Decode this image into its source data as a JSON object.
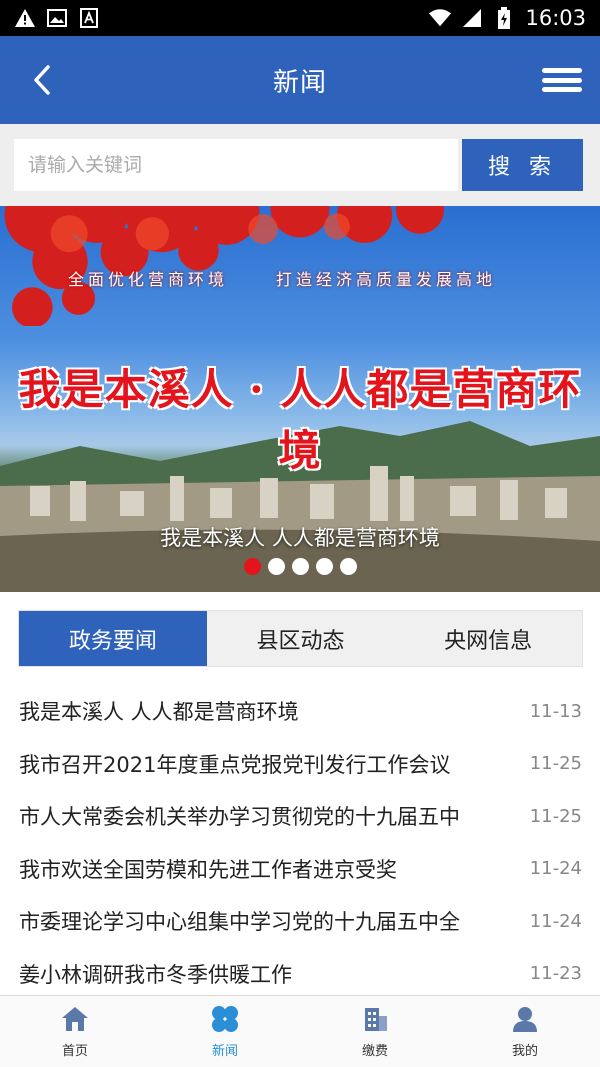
{
  "status_bar": {
    "time": "16:03",
    "icons_left": [
      "warning-icon",
      "image-icon",
      "font-icon"
    ],
    "icons_right": [
      "wifi-icon",
      "signal-icon",
      "battery-icon"
    ]
  },
  "header": {
    "title": "新闻",
    "back_icon": "chevron-left-icon",
    "menu_icon": "hamburger-icon"
  },
  "search": {
    "placeholder": "请输入关键词",
    "button_label": "搜 索"
  },
  "banner": {
    "slogan_left": "全面优化营商环境",
    "slogan_right": "打造经济高质量发展高地",
    "headline": "我是本溪人 · 人人都是营商环境",
    "caption": "我是本溪人 人人都是营商环境",
    "dots": 5,
    "active_dot": 0
  },
  "tabs": [
    {
      "label": "政务要闻",
      "active": true
    },
    {
      "label": "县区动态",
      "active": false
    },
    {
      "label": "央网信息",
      "active": false
    }
  ],
  "news": [
    {
      "title": "我是本溪人 人人都是营商环境",
      "date": "11-13"
    },
    {
      "title": "我市召开2021年度重点党报党刊发行工作会议",
      "date": "11-25"
    },
    {
      "title": "市人大常委会机关举办学习贯彻党的十九届五中",
      "date": "11-25"
    },
    {
      "title": "我市欢送全国劳模和先进工作者进京受奖",
      "date": "11-24"
    },
    {
      "title": "市委理论学习中心组集中学习党的十九届五中全",
      "date": "11-24"
    },
    {
      "title": "姜小林调研我市冬季供暖工作",
      "date": "11-23"
    }
  ],
  "bottom_nav": [
    {
      "label": "首页",
      "icon": "home-icon",
      "active": false
    },
    {
      "label": "新闻",
      "icon": "clover-icon",
      "active": true
    },
    {
      "label": "缴费",
      "icon": "building-icon",
      "active": false
    },
    {
      "label": "我的",
      "icon": "user-icon",
      "active": false
    }
  ],
  "colors": {
    "primary": "#2e62bb",
    "active_dot": "#e3141c",
    "nav_active": "#2a8fd6"
  }
}
